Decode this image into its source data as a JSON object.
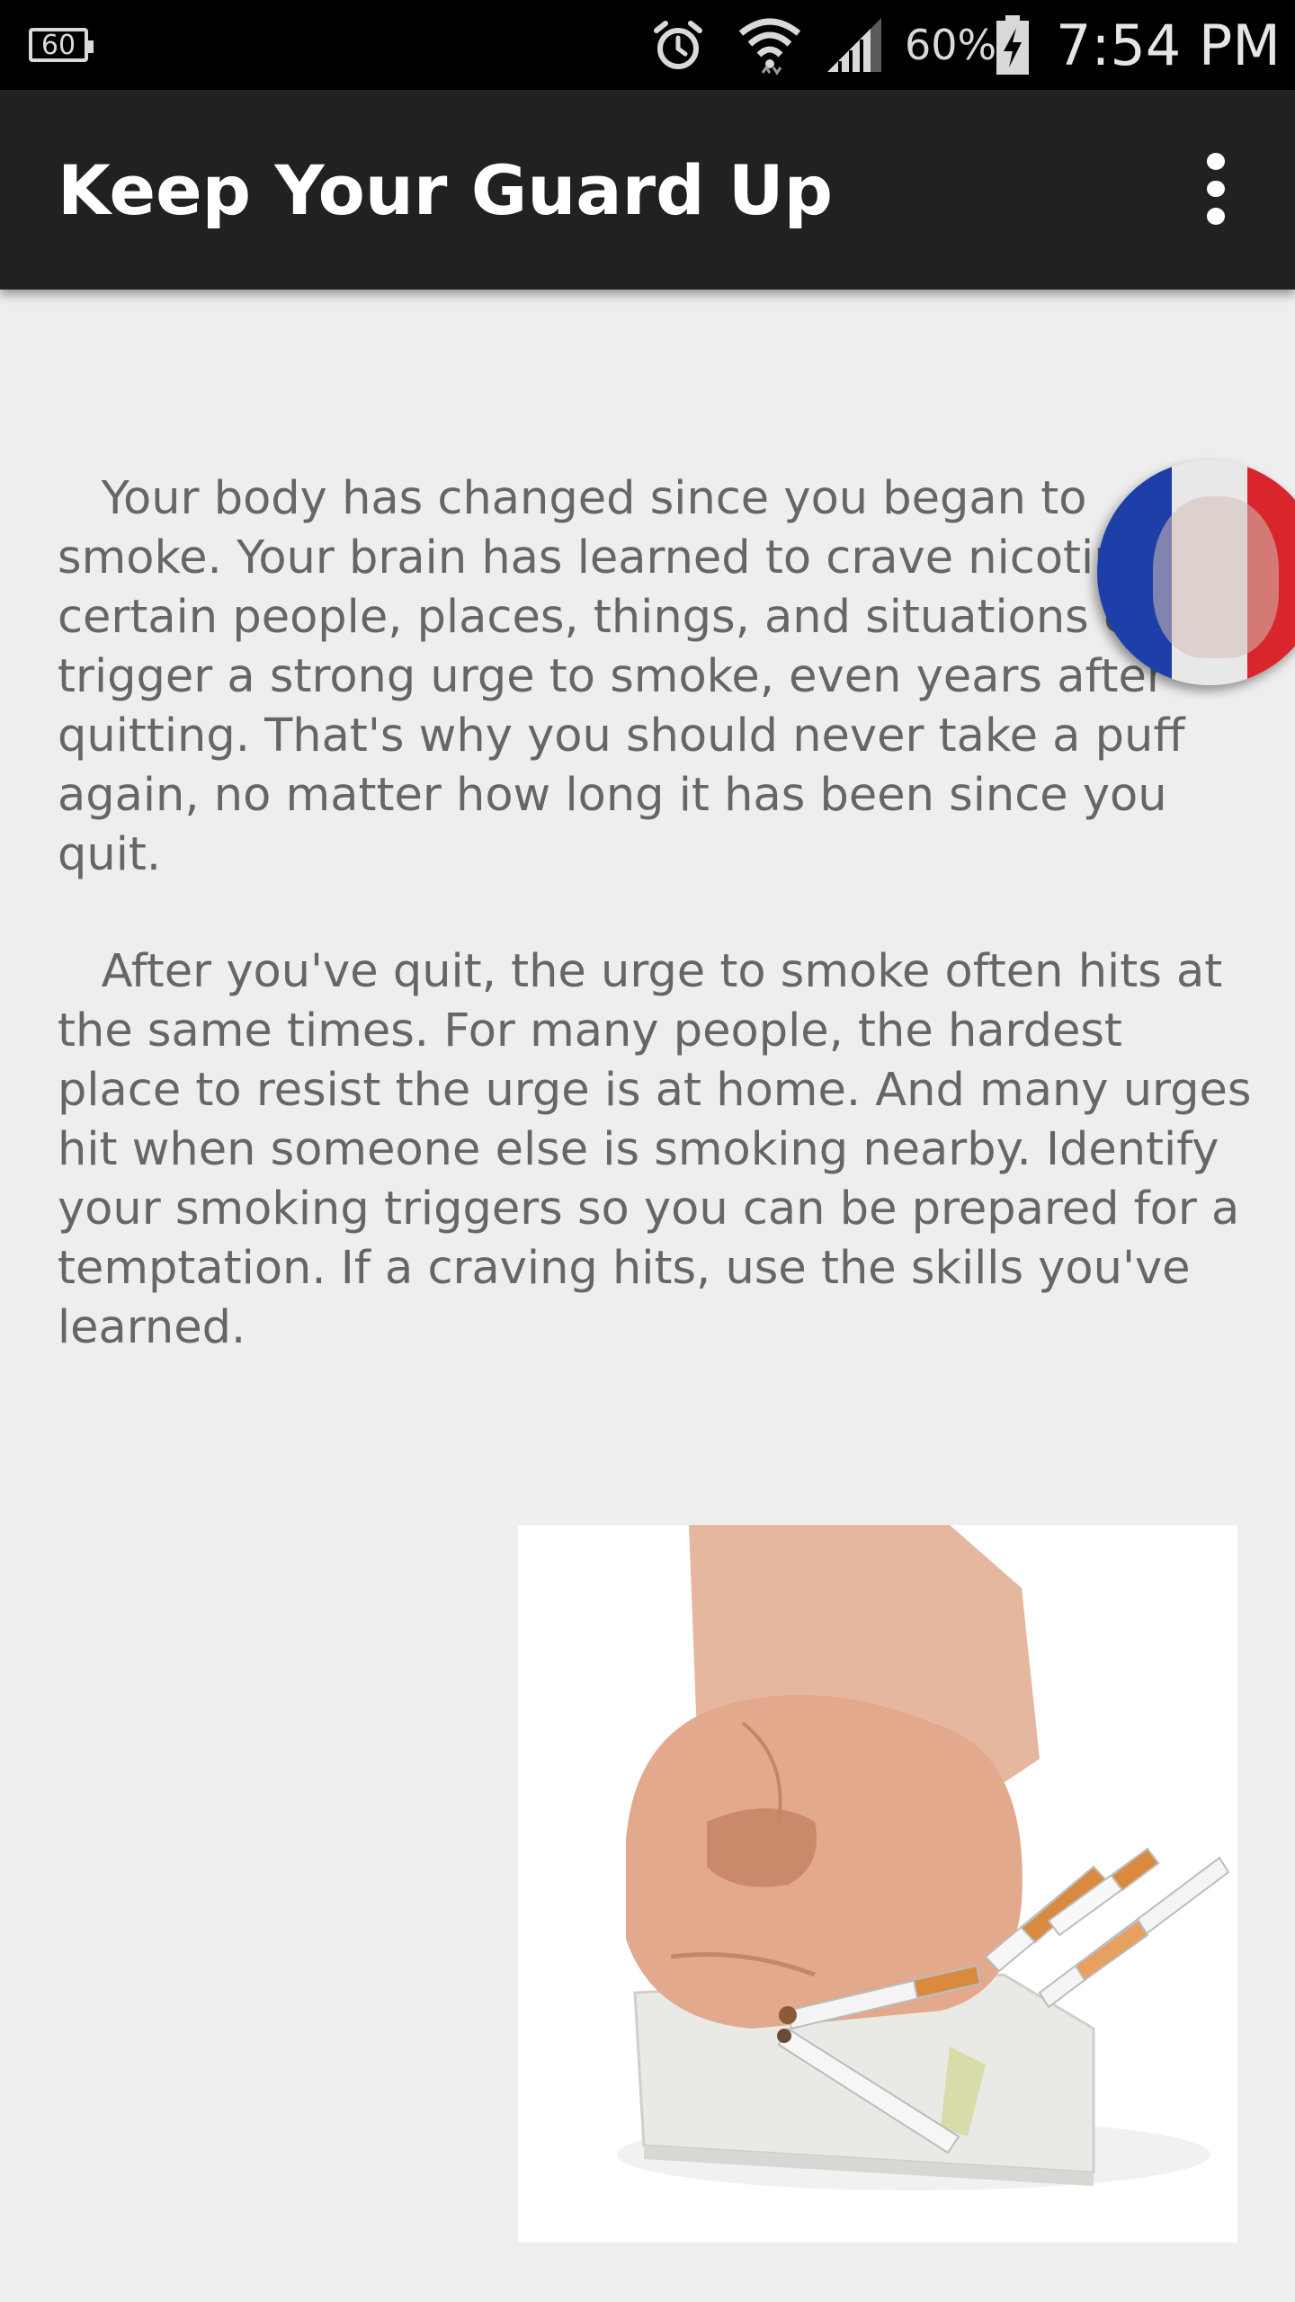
{
  "status_bar": {
    "notification_badge": "60",
    "battery_percent": "60%",
    "time": "7:54 PM",
    "icons": [
      "notification-60-icon",
      "alarm-icon",
      "wifi-icon",
      "signal-icon",
      "battery-charging-icon"
    ]
  },
  "app_bar": {
    "title": "Keep Your Guard Up",
    "menu_icon": "more-vert-icon"
  },
  "content": {
    "paragraph_1": "   Your body has changed since you began to smoke. Your brain has learned to crave nicotine. So certain people, places, things, and situations can trigger a strong urge to smoke, even years after quitting. That's why you should never take a puff again, no matter how long it has been since you quit.",
    "paragraph_2": "   After you've quit, the urge to smoke often hits at the same times. For many people, the hardest place to resist the urge is at home. And many urges hit when someone else is smoking nearby. Identify your smoking triggers so you can be prepared for a temptation. If a craving hits, use the skills you've learned."
  },
  "floating_bubble": {
    "icon": "floating-avatar-icon",
    "colors": [
      "#1f3fa8",
      "#f0f0f0",
      "#d8262c"
    ]
  },
  "illustration": {
    "icon": "fist-crushing-cigarettes-image"
  },
  "colors": {
    "status_bar_bg": "#000000",
    "app_bar_bg": "#212121",
    "page_bg": "#eeeeee",
    "body_text": "#666666"
  }
}
